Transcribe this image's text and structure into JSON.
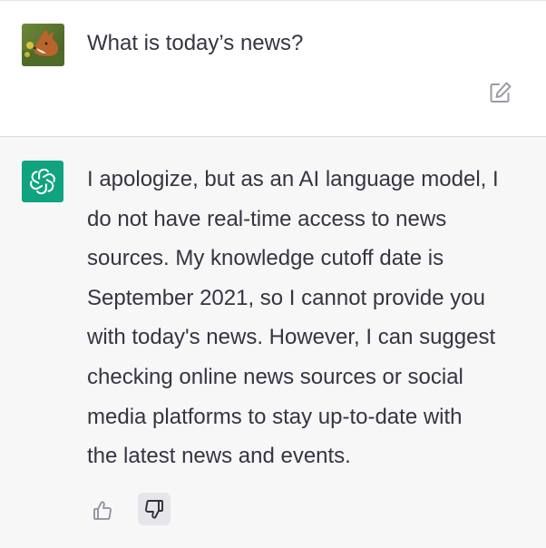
{
  "conversation": {
    "user_message": {
      "avatar_icon": "fox-avatar-icon",
      "text": "What is today’s news?",
      "edit_icon": "edit-icon"
    },
    "assistant_message": {
      "avatar_icon": "openai-logo-icon",
      "brand_color": "#10a37f",
      "lines": [
        "I apologize, but as an AI language model, I",
        "do not have real-time access to news",
        "sources. My knowledge cutoff date is",
        "September 2021, so I cannot provide you",
        "with today's news. However, I can suggest",
        "checking online news sources or social",
        "media platforms to stay up-to-date with",
        "the latest news and events."
      ],
      "feedback": {
        "thumbs_up_icon": "thumbs-up-icon",
        "thumbs_down_icon": "thumbs-down-icon"
      }
    }
  },
  "colors": {
    "text": "#343541",
    "assistant_bg": "#f7f7f8",
    "icon_gray": "#8e8ea0"
  }
}
